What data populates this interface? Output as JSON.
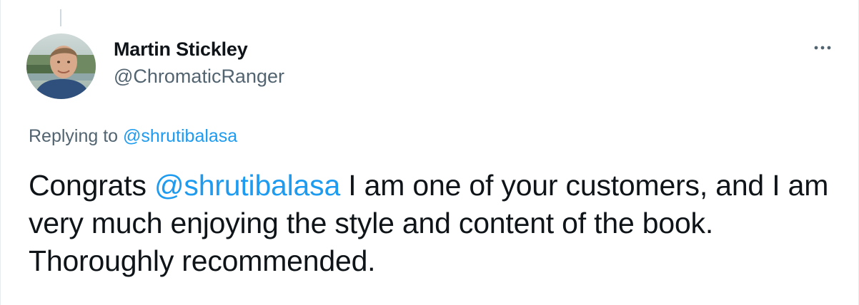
{
  "author": {
    "display_name": "Martin Stickley",
    "handle": "@ChromaticRanger",
    "avatar_icon": "profile-photo"
  },
  "menu": {
    "more_icon": "more-horizontal-icon"
  },
  "reply_context": {
    "prefix": "Replying to",
    "mention": "@shrutibalasa"
  },
  "tweet": {
    "text_before": "Congrats",
    "mention": "@shrutibalasa",
    "text_after": "I am one of your customers, and I am very much enjoying the style and content of the book. Thoroughly recommended."
  },
  "colors": {
    "link": "#1d9bf0",
    "text": "#0f1419",
    "secondary": "#536471"
  }
}
